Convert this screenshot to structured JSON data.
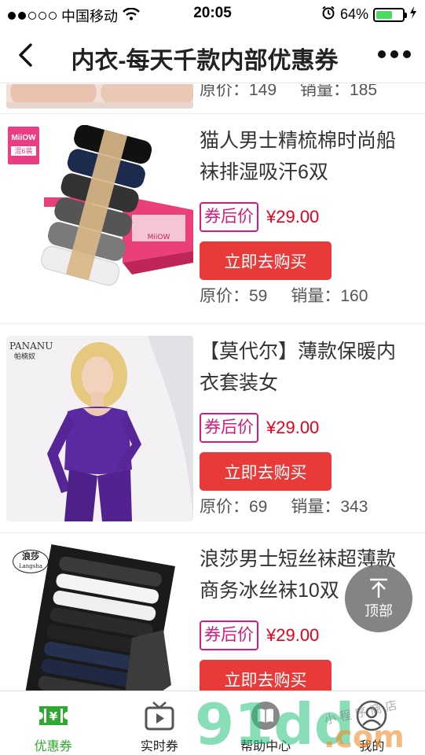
{
  "status": {
    "carrier": "中国移动",
    "time": "20:05",
    "battery_pct": "64%",
    "battery_level": 0.64
  },
  "nav": {
    "title": "内衣-每天千款内部优惠券"
  },
  "items": [
    {
      "meta_orig_label": "原价：",
      "meta_orig": "149",
      "meta_sales_label": "销量：",
      "meta_sales": "185"
    },
    {
      "brand": "MiiOW",
      "brand_sub": "混6装",
      "box_brand": "MiiOW",
      "name": "猫人男士精梳棉时尚船袜排湿吸汗6双",
      "tag": "券后价",
      "price": "¥29.00",
      "buy": "立即去购买",
      "meta_orig_label": "原价：",
      "meta_orig": "59",
      "meta_sales_label": "销量：",
      "meta_sales": "160"
    },
    {
      "brand": "PANANU",
      "brand_sub": "帕楠奴",
      "name": "【莫代尔】薄款保暖内衣套装女",
      "tag": "券后价",
      "price": "¥29.00",
      "buy": "立即去购买",
      "meta_orig_label": "原价：",
      "meta_orig": "69",
      "meta_sales_label": "销量：",
      "meta_sales": "343"
    },
    {
      "brand": "浪莎",
      "brand_sub": "Langsha",
      "name": "浪莎男士短丝袜超薄款商务冰丝袜10双",
      "tag": "券后价",
      "price": "¥29.00",
      "buy": "立即去购买"
    }
  ],
  "back_to_top": "顶部",
  "tabs": [
    {
      "label": "优惠券",
      "icon": "coupon-icon",
      "active": true
    },
    {
      "label": "实时券",
      "icon": "play-tv-icon"
    },
    {
      "label": "帮助中心",
      "icon": "book-icon"
    },
    {
      "label": "我的",
      "icon": "user-icon"
    }
  ],
  "watermark": {
    "text": "91dd",
    "suffix": ".com",
    "handwritten": "小 程 序 商 店"
  },
  "colors": {
    "accent_green": "#2fa82f",
    "tag_magenta": "#d61b7b",
    "price_red": "#e8001a",
    "button_red": "#e93a3a"
  }
}
